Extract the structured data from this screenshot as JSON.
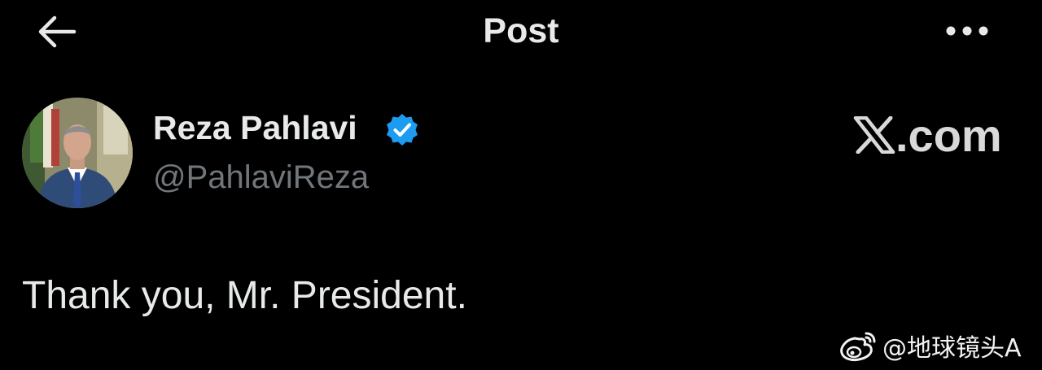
{
  "header": {
    "title": "Post",
    "back_icon": "arrow-left-icon",
    "more_icon": "more-horizontal-icon"
  },
  "post": {
    "author": {
      "display_name": "Reza Pahlavi",
      "handle": "@PahlaviReza",
      "verified": true,
      "verified_color": "#1d9bf0"
    },
    "source_label": ".com",
    "source_icon": "x-logo-icon",
    "text": "Thank you, Mr. President."
  },
  "watermark": {
    "icon": "weibo-logo-icon",
    "text": "@地球镜头A"
  },
  "colors": {
    "background": "#000000",
    "primary_text": "#e7e9ea",
    "secondary_text": "#71767b"
  }
}
